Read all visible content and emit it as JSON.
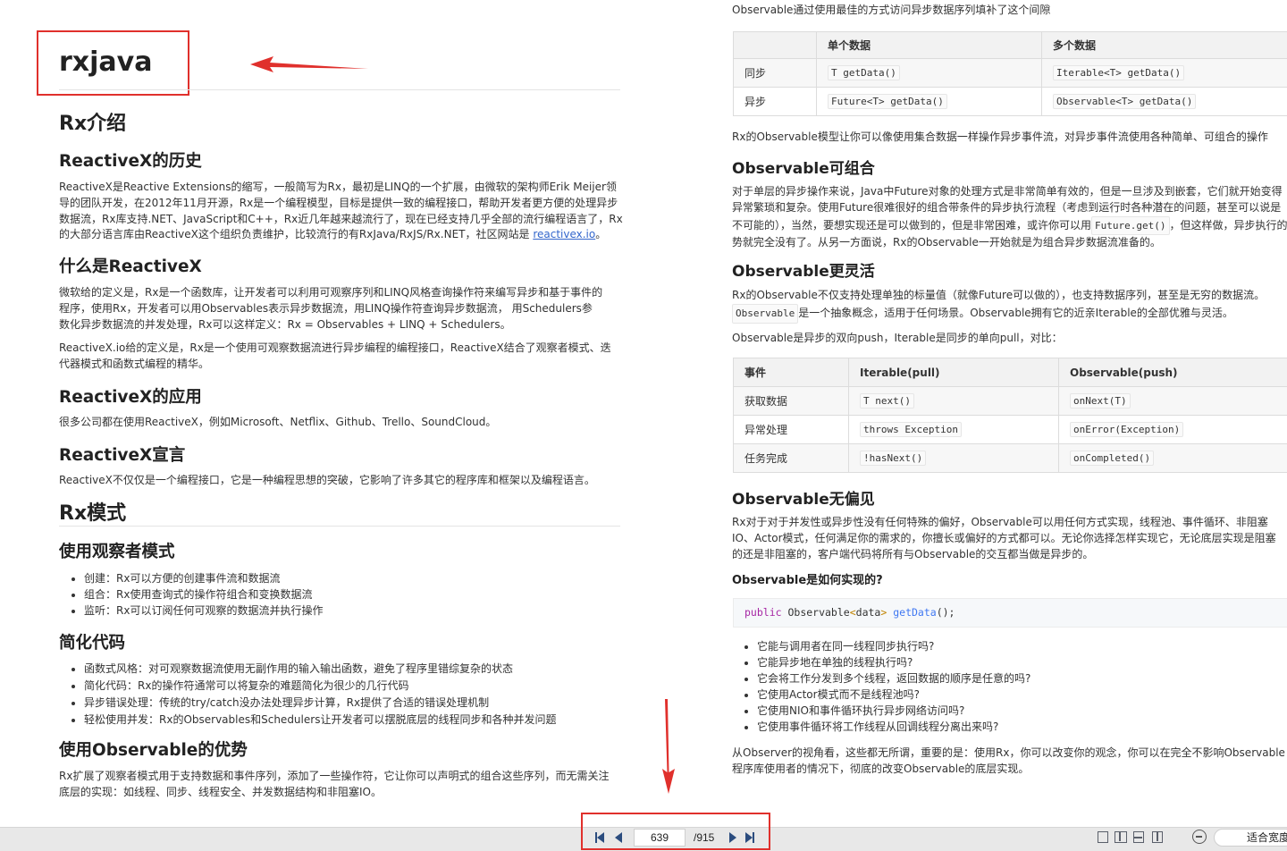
{
  "left": {
    "title": "rxjava",
    "h_rx_intro": "Rx介绍",
    "h_history": "ReactiveX的历史",
    "history_l1": "ReactiveX是Reactive Extensions的缩写，一般简写为Rx，最初是LINQ的一个扩展，由微软的架构师Erik Meijer领",
    "history_l2": "导的团队开发，在2012年11月开源，Rx是一个编程模型，目标是提供一致的编程接口，帮助开发者更方便的处理异步",
    "history_l3": "数据流，Rx库支持.NET、JavaScript和C++，Rx近几年越来越流行了，现在已经支持几乎全部的流行编程语言了，Rx",
    "history_l4_pre": "的大部分语言库由ReactiveX这个组织负责维护，比较流行的有RxJava/RxJS/Rx.NET，社区网站是 ",
    "history_link": "reactivex.io",
    "history_l4_post": "。",
    "h_what": "什么是ReactiveX",
    "what_l1": "微软给的定义是，Rx是一个函数库，让开发者可以利用可观察序列和LINQ风格查询操作符来编写异步和基于事件的",
    "what_l2": "程序，使用Rx，开发者可以用Observables表示异步数据流，用LINQ操作符查询异步数据流， 用Schedulers参",
    "what_l3": "数化异步数据流的并发处理，Rx可以这样定义：Rx = Observables + LINQ + Schedulers。",
    "what2_l1": "ReactiveX.io给的定义是，Rx是一个使用可观察数据流进行异步编程的编程接口，ReactiveX结合了观察者模式、迭",
    "what2_l2": "代器模式和函数式编程的精华。",
    "h_app": "ReactiveX的应用",
    "app_text": "很多公司都在使用ReactiveX，例如Microsoft、Netflix、Github、Trello、SoundCloud。",
    "h_manifesto": "ReactiveX宣言",
    "manifesto_text": "ReactiveX不仅仅是一个编程接口，它是一种编程思想的突破，它影响了许多其它的程序库和框架以及编程语言。",
    "h_rx_mode": "Rx模式",
    "h_observer": "使用观察者模式",
    "observer_items": [
      "创建：Rx可以方便的创建事件流和数据流",
      "组合：Rx使用查询式的操作符组合和变换数据流",
      "监听：Rx可以订阅任何可观察的数据流并执行操作"
    ],
    "h_simplify": "简化代码",
    "simplify_items": [
      "函数式风格：对可观察数据流使用无副作用的输入输出函数，避免了程序里错综复杂的状态",
      "简化代码：Rx的操作符通常可以将复杂的难题简化为很少的几行代码",
      "异步错误处理：传统的try/catch没办法处理异步计算，Rx提供了合适的错误处理机制",
      "轻松使用并发：Rx的Observables和Schedulers让开发者可以摆脱底层的线程同步和各种并发问题"
    ],
    "h_advantage": "使用Observable的优势",
    "adv_l1": "Rx扩展了观察者模式用于支持数据和事件序列，添加了一些操作符，它让你可以声明式的组合这些序列，而无需关注",
    "adv_l2": "底层的实现：如线程、同步、线程安全、并发数据结构和非阻塞IO。"
  },
  "right": {
    "intro": "Observable通过使用最佳的方式访问异步数据序列填补了这个间隙",
    "table1": {
      "headers": [
        "",
        "单个数据",
        "多个数据"
      ],
      "rows": [
        [
          "同步",
          "T getData()",
          "Iterable<T> getData()"
        ],
        [
          "异步",
          "Future<T> getData()",
          "Observable<T> getData()"
        ]
      ]
    },
    "model_text": "Rx的Observable模型让你可以像使用集合数据一样操作异步事件流，对异步事件流使用各种简单、可组合的操作",
    "h_composable": "Observable可组合",
    "comp_l1": "对于单层的异步操作来说，Java中Future对象的处理方式是非常简单有效的，但是一旦涉及到嵌套，它们就开始变得",
    "comp_l2": "异常繁琐和复杂。使用Future很难很好的组合带条件的异步执行流程（考虑到运行时各种潜在的问题，甚至可以说是",
    "comp_l3_pre": "不可能的），当然，要想实现还是可以做到的，但是非常困难，或许你可以用",
    "comp_l3_code": "Future.get()",
    "comp_l3_post": "，但这样做，异步执行的优",
    "comp_l4": "势就完全没有了。从另一方面说，Rx的Observable一开始就是为组合异步数据流准备的。",
    "h_flexible": "Observable更灵活",
    "flex_l1": "Rx的Observable不仅支持处理单独的标量值（就像Future可以做的），也支持数据序列，甚至是无穷的数据流。",
    "flex_l2_code": "Observable",
    "flex_l2_post": "是一个抽象概念，适用于任何场景。Observable拥有它的近亲Iterable的全部优雅与灵活。",
    "async_push": "Observable是异步的双向push，Iterable是同步的单向pull，对比：",
    "table2": {
      "headers": [
        "事件",
        "Iterable(pull)",
        "Observable(push)"
      ],
      "rows": [
        [
          "获取数据",
          "T next()",
          "onNext(T)"
        ],
        [
          "异常处理",
          "throws Exception",
          "onError(Exception)"
        ],
        [
          "任务完成",
          "!hasNext()",
          "onCompleted()"
        ]
      ]
    },
    "h_unbiased": "Observable无偏见",
    "unb_l1": "Rx对于对于并发性或异步性没有任何特殊的偏好，Observable可以用任何方式实现，线程池、事件循环、非阻塞",
    "unb_l2": "IO、Actor模式，任何满足你的需求的，你擅长或偏好的方式都可以。无论你选择怎样实现它，无论底层实现是阻塞",
    "unb_l3": "的还是非阻塞的，客户端代码将所有与Observable的交互都当做是异步的。",
    "h_how": "Observable是如何实现的?",
    "code": {
      "kw": "public",
      "type": " Observable",
      "lt": "<",
      "generic": "data",
      "gt": ">",
      "fn": "getData",
      "tail": "();"
    },
    "questions": [
      "它能与调用者在同一线程同步执行吗?",
      "它能异步地在单独的线程执行吗?",
      "它会将工作分发到多个线程，返回数据的顺序是任意的吗?",
      "它使用Actor模式而不是线程池吗?",
      "它使用NIO和事件循环执行异步网络访问吗?",
      "它使用事件循环将工作线程从回调线程分离出来吗?"
    ],
    "end_l1": "从Observer的视角看，这些都无所谓，重要的是：使用Rx，你可以改变你的观念，你可以在完全不影响Observable",
    "end_l2": "程序库使用者的情况下，彻底的改变Observable的底层实现。"
  },
  "status_bar": {
    "current_page": "639",
    "total_pages": "/915",
    "zoom_mode": "适合宽度"
  },
  "colors": {
    "annotation": "#e0302c",
    "link": "#3366cc",
    "statusbar_bg": "#e8e8e8"
  },
  "icons": [
    "first-page-icon",
    "prev-page-icon",
    "next-page-icon",
    "last-page-icon",
    "single-page-view-icon",
    "double-page-view-icon",
    "continuous-view-icon",
    "book-view-icon",
    "zoom-out-icon"
  ]
}
